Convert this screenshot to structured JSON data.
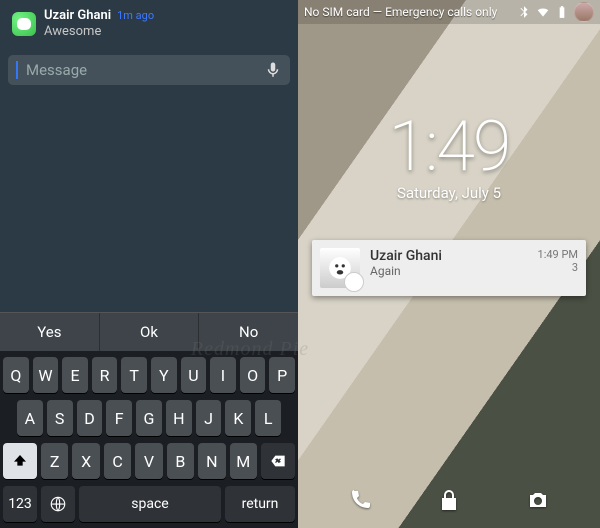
{
  "ios": {
    "sender": "Uzair Ghani",
    "time_ago": "1m ago",
    "preview": "Awesome",
    "input_placeholder": "Message",
    "quick_replies": [
      "Yes",
      "Ok",
      "No"
    ],
    "row1": [
      "Q",
      "W",
      "E",
      "R",
      "T",
      "Y",
      "U",
      "I",
      "O",
      "P"
    ],
    "row2": [
      "A",
      "S",
      "D",
      "F",
      "G",
      "H",
      "J",
      "K",
      "L"
    ],
    "row3": [
      "Z",
      "X",
      "C",
      "V",
      "B",
      "N",
      "M"
    ],
    "numkey": "123",
    "space": "space",
    "return": "return"
  },
  "android": {
    "status_text": "No SIM card — Emergency calls only",
    "clock_time": "1:49",
    "clock_date": "Saturday, July 5",
    "notif": {
      "title": "Uzair Ghani",
      "subtitle": "Again",
      "time": "1:49 PM",
      "count": "3"
    }
  },
  "watermark": "Redmond Pie"
}
